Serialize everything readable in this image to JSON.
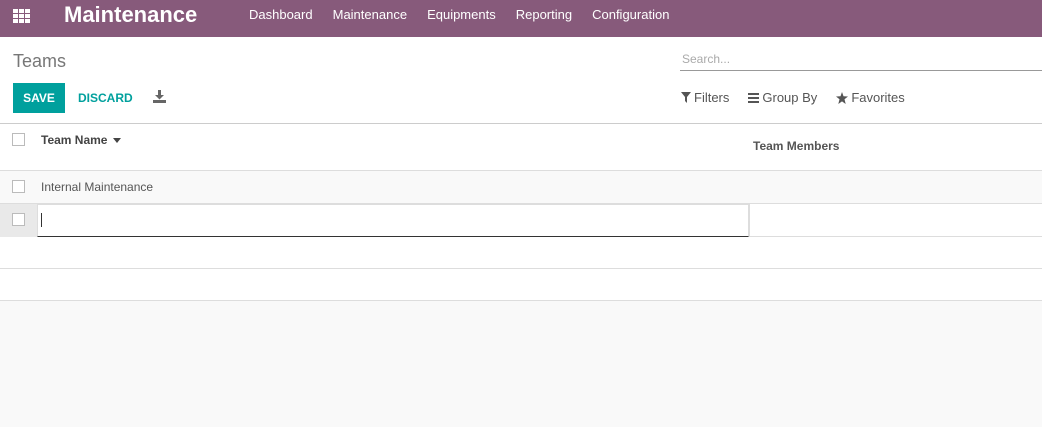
{
  "app": {
    "title": "Maintenance"
  },
  "menu": [
    "Dashboard",
    "Maintenance",
    "Equipments",
    "Reporting",
    "Configuration"
  ],
  "breadcrumb": "Teams",
  "search": {
    "placeholder": "Search..."
  },
  "buttons": {
    "save": "SAVE",
    "discard": "DISCARD"
  },
  "filters": {
    "filters": "Filters",
    "group_by": "Group By",
    "favorites": "Favorites"
  },
  "list": {
    "columns": {
      "name": "Team Name",
      "members": "Team Members"
    },
    "rows": [
      {
        "name": "Internal Maintenance",
        "members": ""
      }
    ],
    "editing_value": ""
  },
  "colors": {
    "topbar": "#875a7b",
    "primary": "#00a09d"
  }
}
